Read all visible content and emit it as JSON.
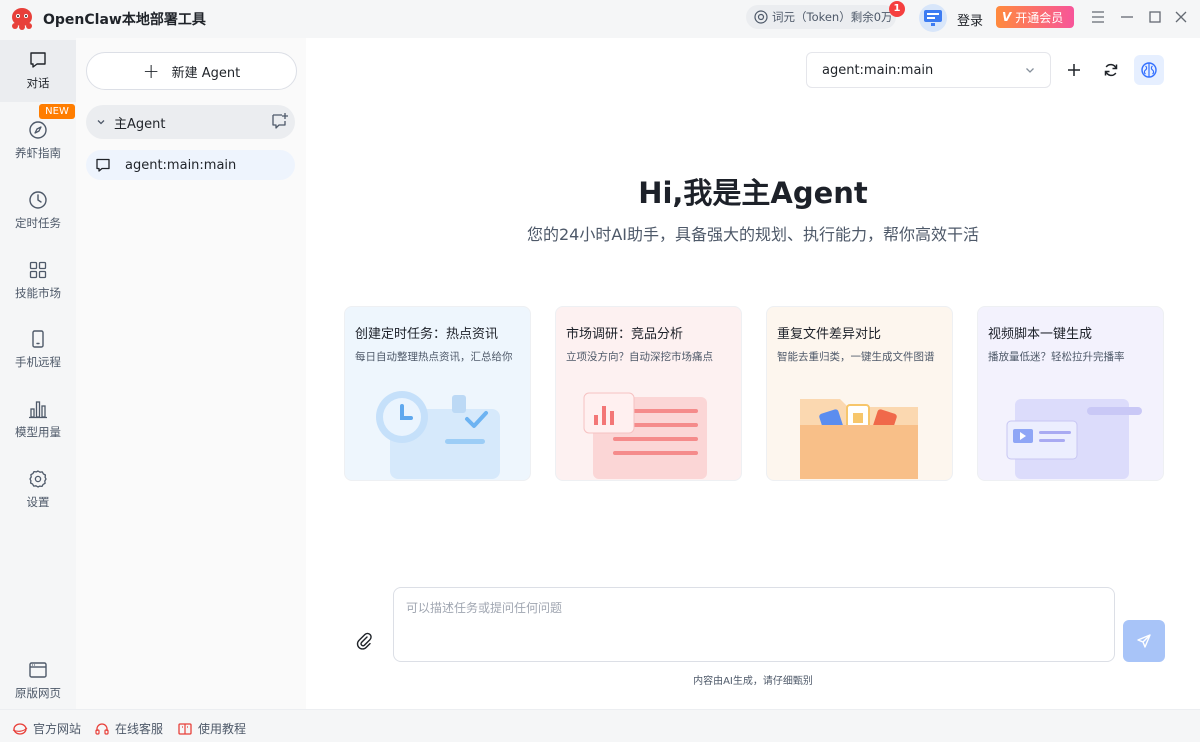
{
  "app": {
    "title": "OpenClaw本地部署工具"
  },
  "titlebar": {
    "token_label": "词元（Token）剩余0万",
    "notification_count": "1",
    "login_label": "登录",
    "vip_icon_letter": "V",
    "vip_label": "开通会员"
  },
  "rail": {
    "items": [
      {
        "label": "对话",
        "icon": "chat-icon",
        "active": true
      },
      {
        "label": "养虾指南",
        "icon": "compass-icon",
        "badge": "NEW"
      },
      {
        "label": "定时任务",
        "icon": "clock-icon"
      },
      {
        "label": "技能市场",
        "icon": "grid-icon"
      },
      {
        "label": "手机远程",
        "icon": "phone-icon"
      },
      {
        "label": "模型用量",
        "icon": "bar-chart-icon"
      },
      {
        "label": "设置",
        "icon": "gear-icon"
      }
    ],
    "bottom_item": {
      "label": "原版网页",
      "icon": "browser-icon"
    }
  },
  "agents": {
    "new_button_label": "新建 Agent",
    "group_label": "主Agent",
    "session_label": "agent:main:main"
  },
  "main": {
    "selected_agent": "agent:main:main",
    "hero_title": "Hi,我是主Agent",
    "hero_subtitle": "您的24小时AI助手，具备强大的规划、执行能力，帮你高效干活",
    "cards": [
      {
        "title": "创建定时任务：热点资讯",
        "desc": "每日自动整理热点资讯，汇总给你",
        "bg": "#eef6fd"
      },
      {
        "title": "市场调研：竞品分析",
        "desc": "立项没方向？自动深挖市场痛点",
        "bg": "#fdf1f1"
      },
      {
        "title": "重复文件差异对比",
        "desc": "智能去重归类，一键生成文件图谱",
        "bg": "#fdf6ee"
      },
      {
        "title": "视频脚本一键生成",
        "desc": "播放量低迷？轻松拉升完播率",
        "bg": "#f3f2fd"
      }
    ],
    "input_placeholder": "可以描述任务或提问任何问题",
    "disclaimer": "内容由AI生成，请仔细甄别"
  },
  "footer": {
    "links": [
      {
        "label": "官方网站",
        "icon": "globe-icon"
      },
      {
        "label": "在线客服",
        "icon": "headset-icon"
      },
      {
        "label": "使用教程",
        "icon": "book-icon"
      }
    ]
  },
  "colors": {
    "accent": "#3370ff",
    "vip_gradient_start": "#ff8a3d",
    "vip_gradient_end": "#f7559a",
    "badge_red": "#f53f3f",
    "new_badge": "#ff7d00"
  }
}
